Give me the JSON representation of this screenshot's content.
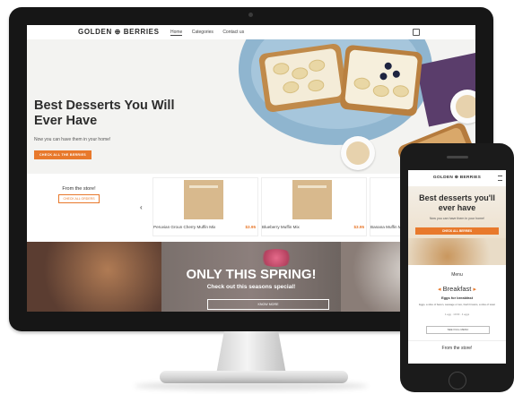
{
  "desktop": {
    "nav": {
      "logo": "GOLDEN ⊕ BERRIES",
      "links": [
        "Home",
        "Categories",
        "Contact us"
      ],
      "active_link": "Home"
    },
    "hero": {
      "title": "Best Desserts You Will Ever Have",
      "subtitle": "Now you can have them in your home!",
      "button_label": "CHECK ALL THE BERRIES"
    },
    "store": {
      "title": "From the store!",
      "button_label": "CHECK ALL ORDERS",
      "products": [
        {
          "name": "Peruvian Groun Cherry Muffin Mix",
          "price": "$3.95"
        },
        {
          "name": "Blueberry Muffin Mix",
          "price": "$3.95"
        },
        {
          "name": "Banana Muffin Mix",
          "price": ""
        }
      ]
    },
    "promo": {
      "title": "ONLY THIS SPRING!",
      "subtitle": "Check out this seasons special!",
      "button_label": "KNOW MORE"
    }
  },
  "phone": {
    "logo": "GOLDEN ⊕ BERRIES",
    "hero": {
      "title": "Best desserts you'll ever have",
      "subtitle": "Now you can have them in your home!",
      "button_label": "CHECK ALL BERRIES"
    },
    "menu": {
      "title": "Menu",
      "category": "Breakfast",
      "item": "Eggs for breakfast",
      "description": "Eggs, a slice of bacon, sausage or two, hash browns, a slice of toast",
      "meta": "1 egg · 10:00 · 4 eggs",
      "button_label": "SEE FULL MENU"
    },
    "store_title": "From the store!"
  },
  "colors": {
    "accent": "#e8792c",
    "device": "#161616",
    "text": "#2d2d2d"
  }
}
